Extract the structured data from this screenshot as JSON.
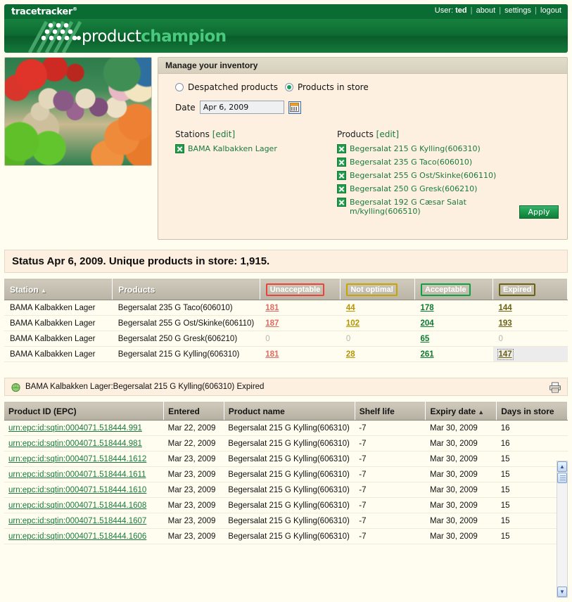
{
  "header": {
    "logo_text": "tracetracker",
    "brand_word1": "product",
    "brand_word2": "champion",
    "nav": {
      "user_prefix": "User:",
      "user_name": "ted",
      "about": "about",
      "settings": "settings",
      "logout": "logout",
      "separator": "|"
    }
  },
  "panel": {
    "title": "Manage your inventory",
    "radios": [
      {
        "label": "Despatched products",
        "checked": false
      },
      {
        "label": "Products in store",
        "checked": true
      }
    ],
    "date_label": "Date",
    "date_value": "Apr 6, 2009",
    "date_placeholder": "Apr 6, 2009",
    "calendar_icon": "calendar-icon",
    "stations": {
      "heading": "Stations",
      "edit_label": "[edit]",
      "items": [
        {
          "label": "BAMA Kalbakken Lager",
          "checked": true
        }
      ]
    },
    "products": {
      "heading": "Products",
      "edit_label": "[edit]",
      "items": [
        {
          "label": "Begersalat 215 G Kylling(606310)",
          "checked": true
        },
        {
          "label": "Begersalat 235 G Taco(606010)",
          "checked": true
        },
        {
          "label": "Begersalat 255 G Ost/Skinke(606110)",
          "checked": true
        },
        {
          "label": "Begersalat 250 G Gresk(606210)",
          "checked": true
        },
        {
          "label": "Begersalat 192 G Cæsar Salat m/kylling(606510)",
          "checked": true
        }
      ]
    },
    "apply_label": "Apply"
  },
  "status": {
    "text": "Status Apr 6, 2009. Unique products in store: 1,915."
  },
  "summary_table": {
    "columns": [
      {
        "label": "Station",
        "style": "plain",
        "sorted": true,
        "sort_arrow": "▲"
      },
      {
        "label": "Products",
        "style": "plain",
        "sorted": false
      },
      {
        "label": "Unacceptable",
        "style": "unacceptable",
        "sorted": false
      },
      {
        "label": "Not optimal",
        "style": "notoptimal",
        "sorted": false
      },
      {
        "label": "Acceptable",
        "style": "acceptable",
        "sorted": false
      },
      {
        "label": "Expired",
        "style": "expired",
        "sorted": false
      }
    ],
    "rows": [
      {
        "station": "BAMA Kalbakken Lager",
        "product": "Begersalat 235 G Taco(606010)",
        "unacceptable": "181",
        "not_optimal": "44",
        "acceptable": "178",
        "expired": "144",
        "selected": ""
      },
      {
        "station": "BAMA Kalbakken Lager",
        "product": "Begersalat 255 G Ost/Skinke(606110)",
        "unacceptable": "187",
        "not_optimal": "102",
        "acceptable": "204",
        "expired": "193",
        "selected": ""
      },
      {
        "station": "BAMA Kalbakken Lager",
        "product": "Begersalat 250 G Gresk(606210)",
        "unacceptable": "0",
        "not_optimal": "0",
        "acceptable": "65",
        "expired": "0",
        "selected": ""
      },
      {
        "station": "BAMA Kalbakken Lager",
        "product": "Begersalat 215 G Kylling(606310)",
        "unacceptable": "181",
        "not_optimal": "28",
        "acceptable": "261",
        "expired": "147",
        "selected": "expired"
      }
    ]
  },
  "detail": {
    "icon": "lettuce-icon",
    "title": "BAMA Kalbakken Lager:Begersalat 215 G Kylling(606310) Expired",
    "print_icon": "printer-icon",
    "columns": [
      {
        "label": "Product ID (EPC)",
        "sorted": false
      },
      {
        "label": "Entered",
        "sorted": false
      },
      {
        "label": "Product name",
        "sorted": false
      },
      {
        "label": "Shelf life",
        "sorted": false
      },
      {
        "label": "Expiry date",
        "sorted": true,
        "sort_arrow": "▲"
      },
      {
        "label": "Days in store",
        "sorted": false
      }
    ],
    "rows": [
      {
        "epc": "urn:epc:id:sqtin:0004071.518444.991",
        "entered": "Mar 22, 2009",
        "name": "Begersalat 215 G Kylling(606310)",
        "shelf_life": "-7",
        "expiry": "Mar 30, 2009",
        "days": "16"
      },
      {
        "epc": "urn:epc:id:sqtin:0004071.518444.981",
        "entered": "Mar 22, 2009",
        "name": "Begersalat 215 G Kylling(606310)",
        "shelf_life": "-7",
        "expiry": "Mar 30, 2009",
        "days": "16"
      },
      {
        "epc": "urn:epc:id:sqtin:0004071.518444.1612",
        "entered": "Mar 23, 2009",
        "name": "Begersalat 215 G Kylling(606310)",
        "shelf_life": "-7",
        "expiry": "Mar 30, 2009",
        "days": "15"
      },
      {
        "epc": "urn:epc:id:sqtin:0004071.518444.1611",
        "entered": "Mar 23, 2009",
        "name": "Begersalat 215 G Kylling(606310)",
        "shelf_life": "-7",
        "expiry": "Mar 30, 2009",
        "days": "15"
      },
      {
        "epc": "urn:epc:id:sqtin:0004071.518444.1610",
        "entered": "Mar 23, 2009",
        "name": "Begersalat 215 G Kylling(606310)",
        "shelf_life": "-7",
        "expiry": "Mar 30, 2009",
        "days": "15"
      },
      {
        "epc": "urn:epc:id:sqtin:0004071.518444.1608",
        "entered": "Mar 23, 2009",
        "name": "Begersalat 215 G Kylling(606310)",
        "shelf_life": "-7",
        "expiry": "Mar 30, 2009",
        "days": "15"
      },
      {
        "epc": "urn:epc:id:sqtin:0004071.518444.1607",
        "entered": "Mar 23, 2009",
        "name": "Begersalat 215 G Kylling(606310)",
        "shelf_life": "-7",
        "expiry": "Mar 30, 2009",
        "days": "15"
      },
      {
        "epc": "urn:epc:id:sqtin:0004071.518444.1606",
        "entered": "Mar 23, 2009",
        "name": "Begersalat 215 G Kylling(606310)",
        "shelf_life": "-7",
        "expiry": "Mar 30, 2009",
        "days": "15"
      }
    ]
  },
  "scrollbar": {
    "up_glyph": "▲",
    "down_glyph": "▼"
  },
  "colors": {
    "brand_green": "#0a6b33",
    "accent_green": "#49c97e",
    "unacceptable": "#e8443c",
    "not_optimal": "#c8a400",
    "acceptable": "#0aa33f",
    "expired": "#6b6112",
    "panel_bg": "#fdf0e0"
  }
}
